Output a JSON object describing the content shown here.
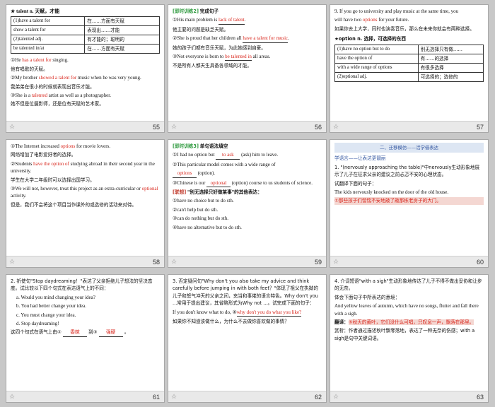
{
  "slides": {
    "s55": {
      "num": "55",
      "title": "★ talent n. 天赋，才能",
      "table": [
        [
          "(1)have a talent for",
          "在……方面有天赋"
        ],
        [
          "show a talent for",
          "表现出……才能"
        ],
        [
          "(2)talented adj.",
          "有才能的；聪明的"
        ],
        [
          "be talented in/at",
          "在……方面有天赋"
        ]
      ],
      "e1_pre": "①He ",
      "e1_red": "has a talent for",
      "e1_post": " singing.",
      "e1_cn": "他有唱歌的天赋。",
      "e2_pre": "②My brother ",
      "e2_red": "showed a talent for",
      "e2_post": " music when he was very young.",
      "e2_cn": "我弟弟在很小的时候就表现出音乐才能。",
      "e3_pre": "③She is a ",
      "e3_red": "talented",
      "e3_post": " artist as well as a photographer.",
      "e3_cn": "她不但是位摄影师，还是位有天赋的艺术家。"
    },
    "s56": {
      "num": "56",
      "hdr": "[即时训练2]",
      "hdr2": "完成句子",
      "l1_pre": "①His main problem is ",
      "l1_red": "lack of talent",
      "l1_post": ".",
      "l1_cn": "他主要的问题是缺乏天赋。",
      "l2_pre": "②She is proud that her children all ",
      "l2_red": "have a talent for music",
      "l2_post": ".",
      "l2_cn": "她的孩子们都有音乐天赋，为此她感到自豪。",
      "l3_pre": "③Not everyone is born to ",
      "l3_red": "be talented in",
      "l3_post": " all areas.",
      "l3_cn": "不是所有人都天生具备各领域的才能。"
    },
    "s57": {
      "num": "57",
      "l1": "9. If you go to university and play music at the same time, you",
      "l2_pre": "will have two ",
      "l2_red": "options",
      "l2_post": " for your future.",
      "l3_cn": "如果你去上大学，同时也演奏音乐，那么在未来你就会有两种选择。",
      "title": "★option n. 选择，可选择的东西",
      "table": [
        [
          "(1)have no option but to do",
          "别无选择只有做……"
        ],
        [
          "have the option of",
          "有……的选择"
        ],
        [
          "with a wide range of options",
          "有很多选择"
        ],
        [
          "(2)optional adj.",
          "可选择的；选修的"
        ]
      ]
    },
    "s58": {
      "num": "58",
      "e1_pre": "①The Internet increased ",
      "e1_red": "options",
      "e1_post": " for movie lovers.",
      "e1_cn": "网络增加了电影爱好者的选择。",
      "e2_pre": "②Students ",
      "e2_red": "have the option of",
      "e2_post": " studying abroad in their second year in the university.",
      "e2_cn": "学生在大学二年级时可以选择出国学习。",
      "e3_pre": "③We will not, however, treat this project as an extra-curricular or ",
      "e3_red": "optional",
      "e3_post": " activity.",
      "e3_cn": "但是，我们不会将这个项目当作课外的或选修的活动来对待。"
    },
    "s59": {
      "num": "59",
      "hdr": "[即时训练3]",
      "hdr2": "单句语法填空",
      "l1_pre": "①I had no option but ",
      "l1_red": "to ask",
      "l1_post": " (ask) him to leave.",
      "l2": "②This particular model comes with a wide range of",
      "l2_red": "options",
      "l2_post": " (option).",
      "l3_pre": "③Chinese is our ",
      "l3_red": "optional",
      "l3_post": " (option) course to us students of science.",
      "lk_hdr": "[联想]",
      "lk_text": "\"别无选择只好做某事\"的其他表达：",
      "lk1": "①have no choice but to do sth.",
      "lk2": "②can't help but do sth.",
      "lk3": "③can do nothing but do sth.",
      "lk4": "④have no alternative but to do sth."
    },
    "s60": {
      "num": "60",
      "bar": "二、迁移模仿——活学借表达",
      "sub": "学语言——让表达更靓丽",
      "l1": "1. \"(nervously approaching the table)\"中nervously生动形象地展示了儿子在征求父亲的建议之前忐忑不安的心理状态。",
      "l2": "试翻译下面的句子：",
      "l3": "The kids nervously knocked on the door of the old house.",
      "l4_red": "①那些孩子们惴惴不安地敲了敲那栋老房子的大门。"
    },
    "s61": {
      "num": "61",
      "l1": "2. 祈使句\"Stop daydreaming！\"表达了父亲拒绝儿子想法的坚决态度。试比较以下四个句式在表达语气上的不同：",
      "a": "a. Would you mind changing your idea?",
      "b": "b. You had better change your idea.",
      "c": "c. You must change your idea.",
      "d": "d. Stop daydreaming!",
      "e_pre": "这四个句式在语气上由② ",
      "e_red1": "委婉",
      "e_mid": " 到③ ",
      "e_red2": "强硬",
      "e_post": " 。"
    },
    "s62": {
      "num": "62",
      "l1": "3. 否定疑问句\"Why don't you also take my advice and think carefully before jumping in with both feet？\"体现了祖父在执拗的儿子和怒气冲天的父亲之间，充当和事佬的语言特色。Why don't you ...常用于提出建议，其省略形式为Why not ...。试完成下面的句子：",
      "l2_pre": "If you don't know what to do, ④",
      "l2_red": "why don't you do what you like?",
      "l3_cn": "如果你不知道该做什么，为什么不去做你喜欢做的事情？"
    },
    "s63": {
      "num": "63",
      "l1": "4. 介词短语\"with a sigh\"生动形象地传达了儿子不得不做出妥协和让步的无奈。",
      "l2": "体会下面句子中所表达的意境：",
      "l3": "And yellow leaves of autumn, which have no songs, flutter and fall there with a sigh.",
      "l4_hdr": "翻译：",
      "l4_red": "⑤秋天的黄叶，它们没什么可唱，只叹息一声，飘落在那里。",
      "l5": "赏析：作者通过描述秋叶飘零落地，表达了一种无奈的伤感；with a sigh是句中关键词语。"
    }
  },
  "icons": {
    "star": "star-icon"
  }
}
